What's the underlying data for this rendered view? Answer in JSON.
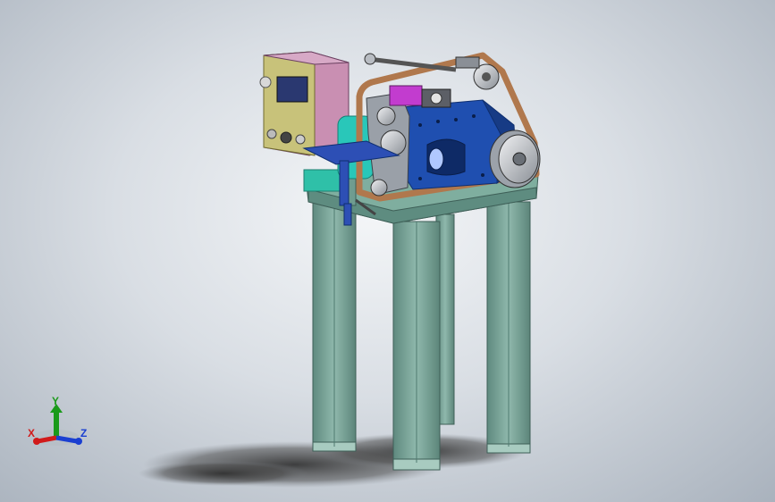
{
  "viewport": {
    "background_top": "#f4f6f8",
    "background_bottom": "#a9b2bd"
  },
  "model": {
    "colors": {
      "frame": "#6f9c90",
      "frame_dark": "#4f7a6f",
      "frame_light": "#8fb8ac",
      "shadow": "#3a3a3a",
      "control_box_face": "#c8c27a",
      "control_box_side": "#c98fb2",
      "screen": "#2a3870",
      "housing": "#1f4fb0",
      "housing_dark": "#173b85",
      "belt": "#b0784d",
      "wheel": "#cfd2d6",
      "table_plate": "#2d4fb5",
      "accent_magenta": "#c23ccf",
      "accent_teal": "#29c7b9"
    }
  },
  "triad": {
    "x_label": "X",
    "y_label": "Y",
    "z_label": "Z",
    "x_color": "#d11a1a",
    "y_color": "#1a9a1a",
    "z_color": "#1a3fd1",
    "x_icon": "arrow-x-icon",
    "y_icon": "arrow-y-icon",
    "z_icon": "arrow-z-icon"
  }
}
